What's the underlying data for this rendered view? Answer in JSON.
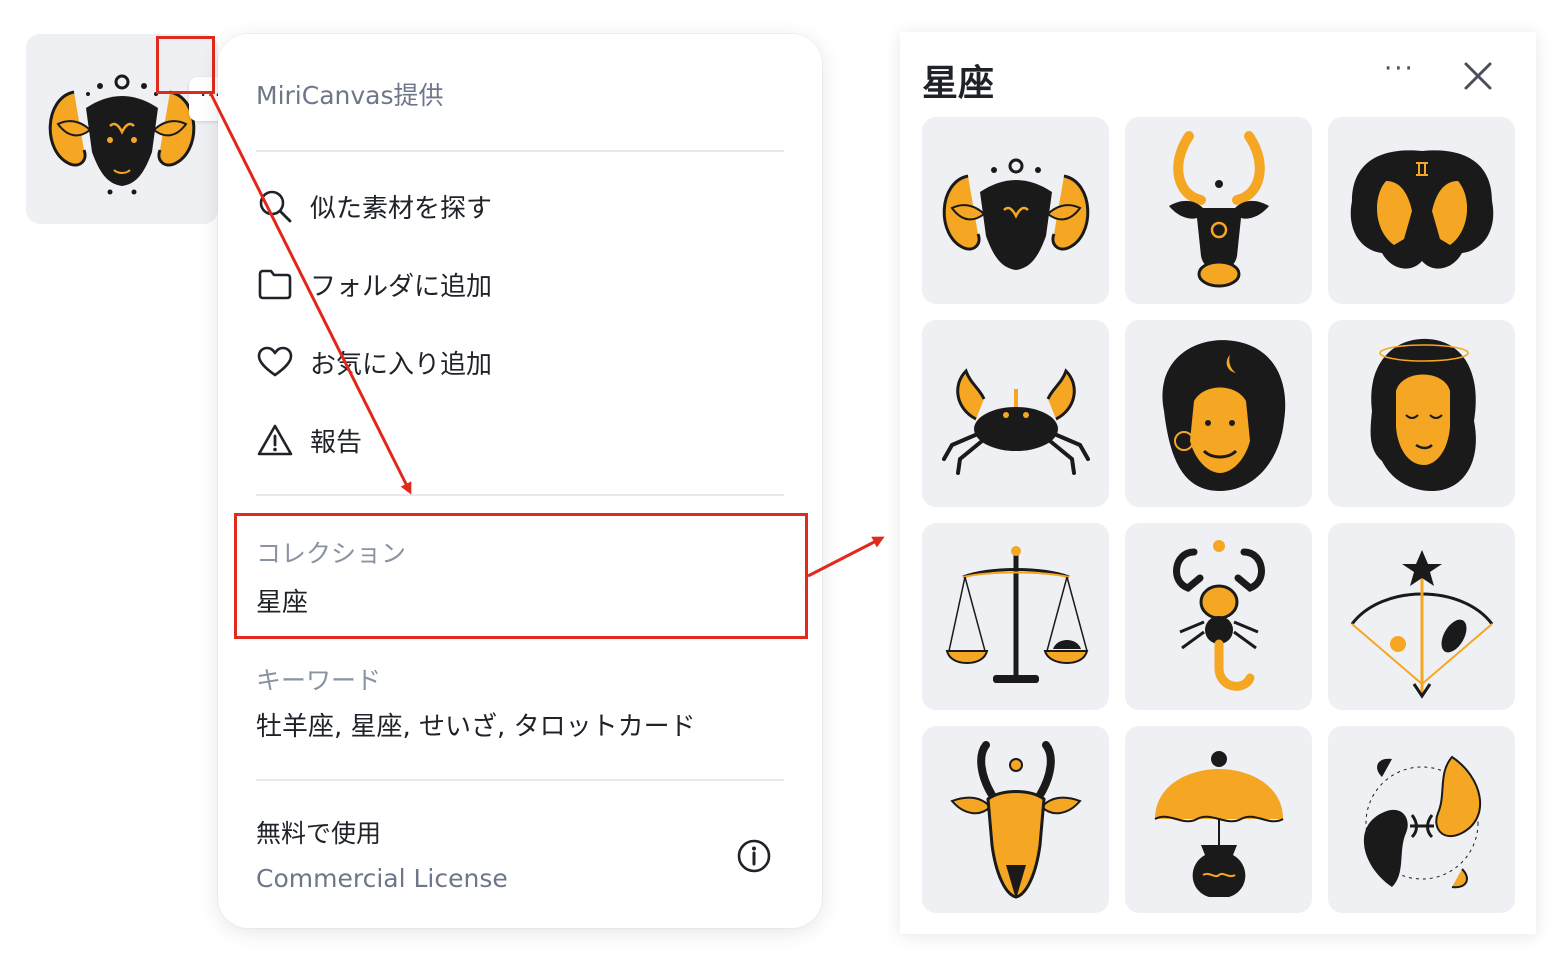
{
  "thumbnail": {
    "icon": "ram-zodiac-icon",
    "more_label": "···"
  },
  "menu": {
    "provider": "MiriCanvas提供",
    "items": [
      {
        "icon": "search-icon",
        "label": "似た素材を探す"
      },
      {
        "icon": "folder-icon",
        "label": "フォルダに追加"
      },
      {
        "icon": "heart-icon",
        "label": "お気に入り追加"
      },
      {
        "icon": "warning-icon",
        "label": "報告"
      }
    ],
    "collection": {
      "title": "コレクション",
      "value": "星座"
    },
    "keywords": {
      "title": "キーワード",
      "value": "牡羊座, 星座, せいざ, タロットカード"
    },
    "license": {
      "free": "無料で使用",
      "link": "Commercial License",
      "info_icon": "info-icon"
    }
  },
  "panel": {
    "title": "星座",
    "more_label": "···",
    "close_icon": "close-icon",
    "tiles": [
      "aries-ram-icon",
      "taurus-bull-icon",
      "gemini-twins-icon",
      "cancer-crab-icon",
      "leo-lion-icon",
      "virgo-maiden-icon",
      "libra-scales-icon",
      "scorpio-scorpion-icon",
      "sagittarius-bow-icon",
      "capricorn-goat-icon",
      "aquarius-vase-icon",
      "pisces-fish-icon"
    ]
  },
  "colors": {
    "accent_orange": "#f5a623",
    "ink": "#1a1a1a",
    "annotation_red": "#e02b1c",
    "tile_bg": "#eff0f3"
  }
}
